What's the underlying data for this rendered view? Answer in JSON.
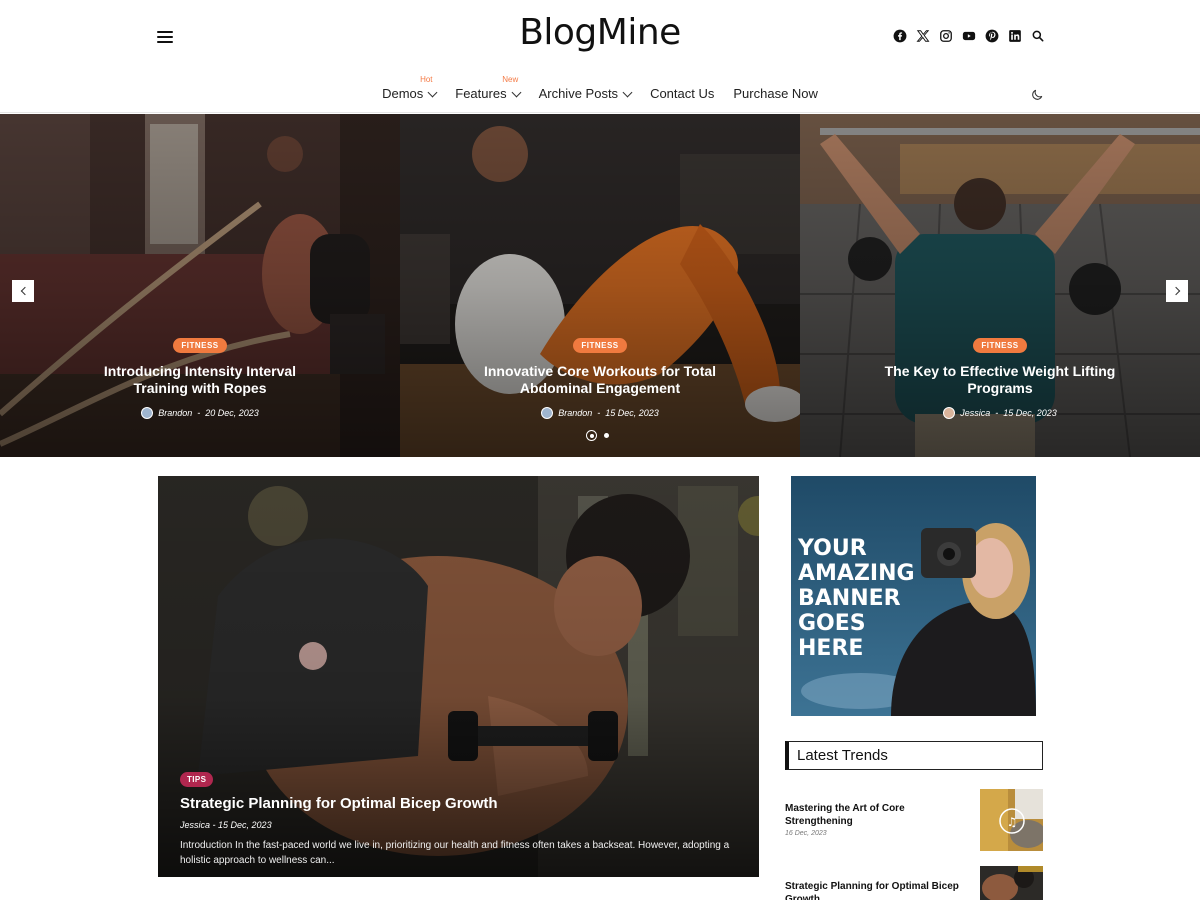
{
  "header": {
    "logo": "BlogMine",
    "nav": [
      {
        "label": "Demos",
        "badge": "Hot",
        "has_dropdown": true
      },
      {
        "label": "Features",
        "badge": "New",
        "has_dropdown": true
      },
      {
        "label": "Archive Posts",
        "badge": "",
        "has_dropdown": true
      },
      {
        "label": "Contact Us",
        "badge": "",
        "has_dropdown": false
      },
      {
        "label": "Purchase Now",
        "badge": "",
        "has_dropdown": false
      }
    ],
    "social_icons": [
      "facebook-icon",
      "x-twitter-icon",
      "instagram-icon",
      "youtube-icon",
      "pinterest-icon",
      "linkedin-icon",
      "search-icon"
    ],
    "theme_toggle_icon": "moon-icon"
  },
  "slider": {
    "slides": [
      {
        "category": "FITNESS",
        "title": "Introducing Intensity Interval Training with Ropes",
        "author": "Brandon",
        "date": "20 Dec, 2023"
      },
      {
        "category": "FITNESS",
        "title": "Innovative Core Workouts for Total Abdominal Engagement",
        "author": "Brandon",
        "date": "15 Dec, 2023"
      },
      {
        "category": "FITNESS",
        "title": "The Key to Effective Weight Lifting Programs",
        "author": "Jessica",
        "date": "15 Dec, 2023"
      }
    ],
    "dots_total": 2,
    "dots_active": 1
  },
  "featured": {
    "category": "TIPS",
    "title": "Strategic Planning for Optimal Bicep Growth",
    "author": "Jessica",
    "date": "15 Dec, 2023",
    "excerpt": "Introduction In the fast-paced world we live in, prioritizing our health and fitness often takes a backseat. However, adopting a holistic approach to wellness can..."
  },
  "sidebar": {
    "banner_lines": [
      "YOUR",
      "AMAZING",
      "BANNER",
      "GOES",
      "HERE"
    ],
    "trends_heading": "Latest Trends",
    "trends": [
      {
        "title": "Mastering the Art of Core Strengthening",
        "date": "16 Dec, 2023"
      },
      {
        "title": "Strategic Planning for Optimal Bicep Growth",
        "date": ""
      }
    ]
  },
  "colors": {
    "accent": "#f07a3f",
    "tips_badge": "#b0274f",
    "text": "#111111"
  }
}
